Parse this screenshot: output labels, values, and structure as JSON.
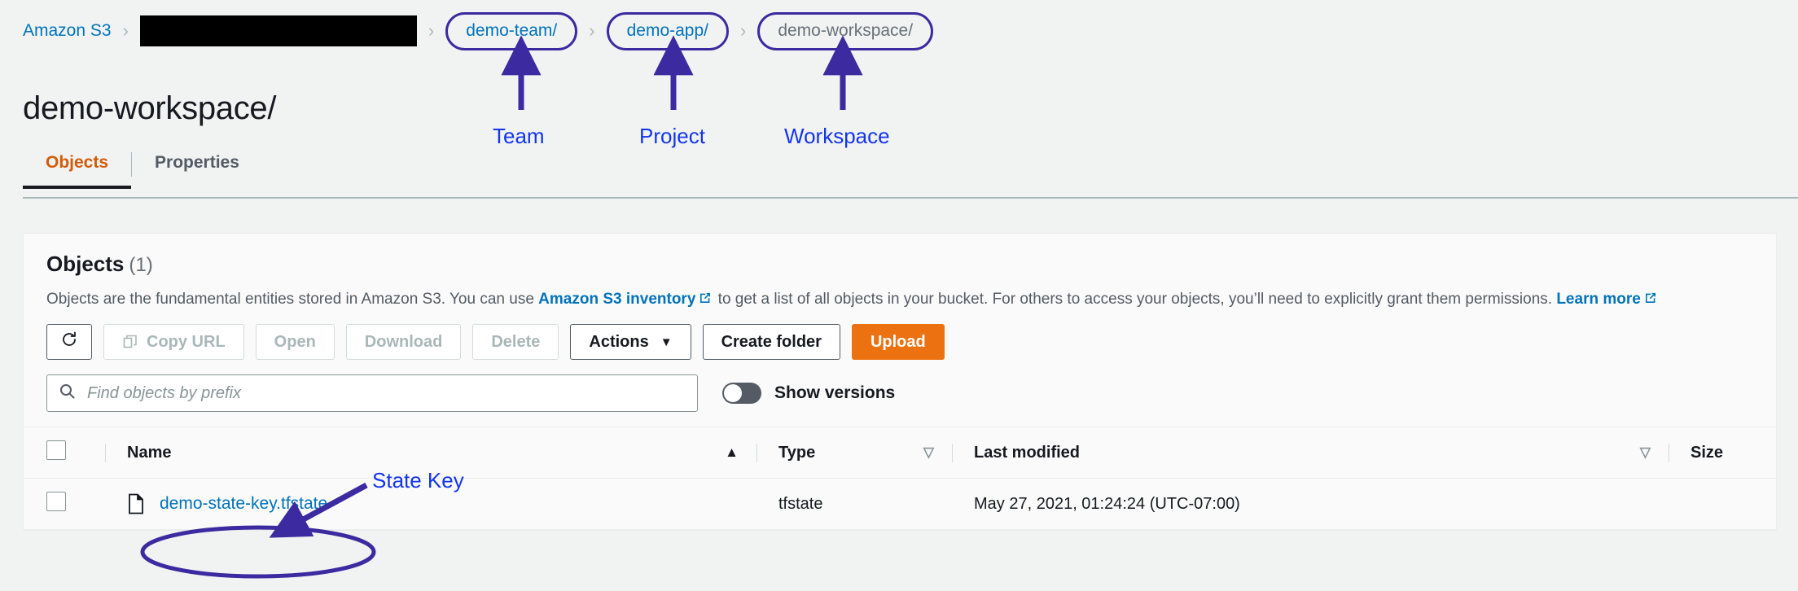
{
  "breadcrumb": {
    "root": "Amazon S3",
    "separator": "›",
    "redacted": "",
    "items": [
      {
        "label": "demo-team/",
        "highlighted": true,
        "current": false
      },
      {
        "label": "demo-app/",
        "highlighted": true,
        "current": false
      },
      {
        "label": "demo-workspace/",
        "highlighted": true,
        "current": true
      }
    ]
  },
  "annotations": {
    "color": "#1335ee",
    "arrow_color": "#3b2aa0",
    "labels": [
      {
        "text": "Team"
      },
      {
        "text": "Project"
      },
      {
        "text": "Workspace"
      },
      {
        "text": "State Key"
      }
    ]
  },
  "page": {
    "title": "demo-workspace/"
  },
  "tabs": [
    {
      "label": "Objects",
      "active": true
    },
    {
      "label": "Properties",
      "active": false
    }
  ],
  "objects_panel": {
    "title": "Objects",
    "count": "(1)",
    "description_pre": "Objects are the fundamental entities stored in Amazon S3. You can use ",
    "link_inventory": "Amazon S3 inventory",
    "description_mid": " to get a list of all objects in your bucket. For others to access your objects, you’ll need to explicitly grant them permissions. ",
    "link_learn_more": "Learn more",
    "toolbar": {
      "refresh_icon": "refresh-icon",
      "copy_url": "Copy URL",
      "open": "Open",
      "download": "Download",
      "delete": "Delete",
      "actions": "Actions",
      "actions_caret": "▼",
      "create_folder": "Create folder",
      "upload": "Upload",
      "upload_color": "#ec7211"
    },
    "search": {
      "placeholder": "Find objects by prefix",
      "value": "",
      "icon": "search-icon"
    },
    "show_versions": {
      "label": "Show versions",
      "on": false
    },
    "table": {
      "columns": [
        {
          "label": "Name",
          "sort": "asc"
        },
        {
          "label": "Type",
          "sort": "desc"
        },
        {
          "label": "Last modified",
          "sort": "desc"
        },
        {
          "label": "Size",
          "sort": "none"
        }
      ],
      "rows": [
        {
          "name": "demo-state-key.tfstate",
          "type": "tfstate",
          "last_modified": "May 27, 2021, 01:24:24 (UTC-07:00)",
          "size": ""
        }
      ]
    }
  }
}
